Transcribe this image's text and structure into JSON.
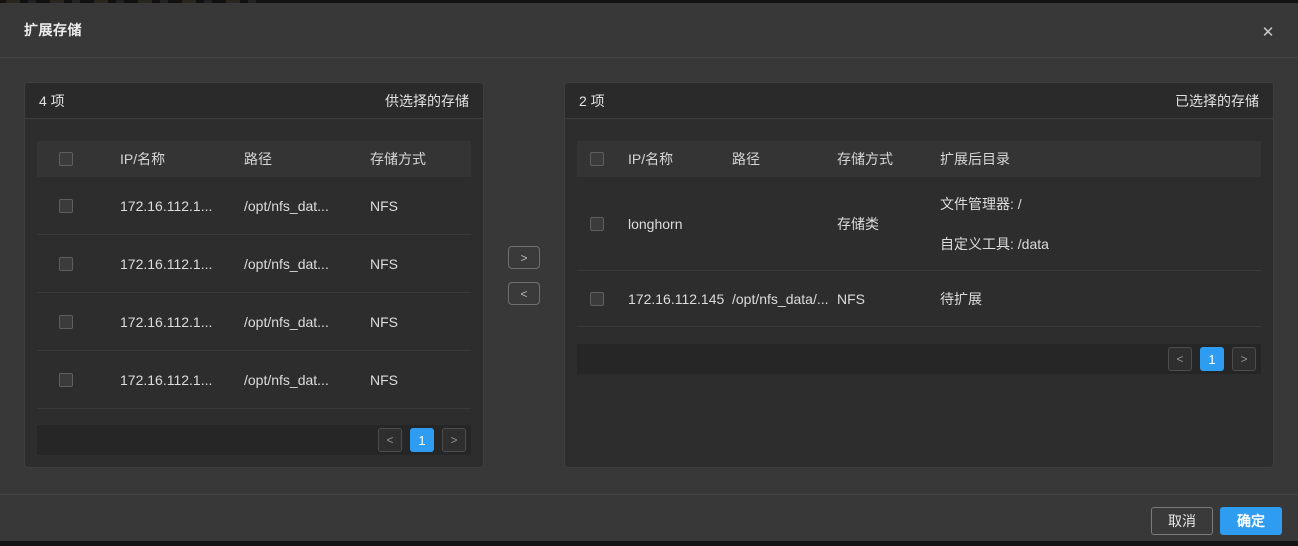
{
  "modal": {
    "title": "扩展存储"
  },
  "icons": {
    "close": "✕",
    "chevron_left": "<",
    "chevron_right": ">"
  },
  "source_panel": {
    "count": "4 项",
    "title": "供选择的存储",
    "columns": {
      "ip": "IP/名称",
      "path": "路径",
      "type": "存储方式"
    },
    "rows": [
      {
        "ip": "172.16.112.1...",
        "path": "/opt/nfs_dat...",
        "type": "NFS"
      },
      {
        "ip": "172.16.112.1...",
        "path": "/opt/nfs_dat...",
        "type": "NFS"
      },
      {
        "ip": "172.16.112.1...",
        "path": "/opt/nfs_dat...",
        "type": "NFS"
      },
      {
        "ip": "172.16.112.1...",
        "path": "/opt/nfs_dat...",
        "type": "NFS"
      }
    ],
    "pagination": {
      "current_page": "1"
    }
  },
  "target_panel": {
    "count": "2 项",
    "title": "已选择的存储",
    "columns": {
      "ip": "IP/名称",
      "path": "路径",
      "type": "存储方式",
      "dir": "扩展后目录"
    },
    "rows": [
      {
        "ip": "longhorn",
        "path": "",
        "type": "存储类",
        "dir_line1": "文件管理器: /",
        "dir_line2": "自定义工具: /data"
      },
      {
        "ip": "172.16.112.145",
        "path": "/opt/nfs_data/...",
        "type": "NFS",
        "dir_line1": "待扩展"
      }
    ],
    "pagination": {
      "current_page": "1"
    }
  },
  "footer": {
    "cancel_label": "取消",
    "confirm_label": "确定"
  },
  "colors": {
    "accent_blue": "#2e9cf0",
    "modal_bg": "#383838",
    "panel_bg": "#2d2d2d"
  }
}
